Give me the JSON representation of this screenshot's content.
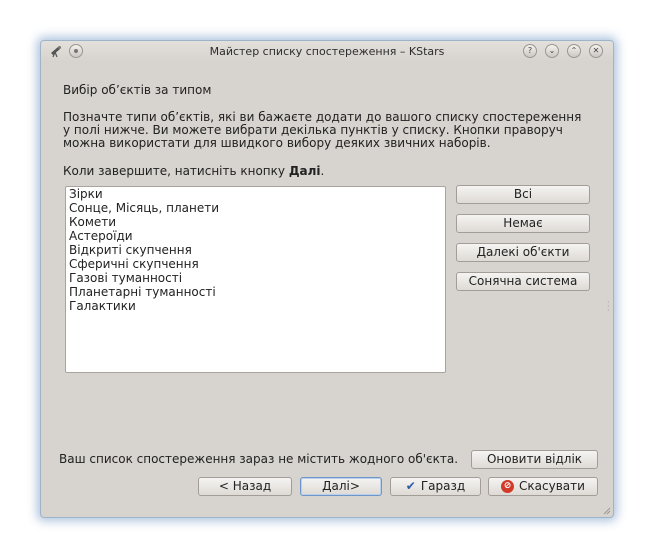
{
  "window": {
    "title": "Майстер списку спостереження – KStars",
    "controls": {
      "help": "?",
      "minimize": "⌄",
      "maximize": "⌃",
      "close": "✕"
    }
  },
  "page": {
    "heading": "Вибір об’єктів за типом",
    "description_lines": [
      "Позначте типи об’єктів, які ви бажаєте додати до вашого списку спостереження",
      "у полі нижче. Ви можете вибрати декілька пунктів у списку. Кнопки праворуч",
      "можна використати для швидкого вибору деяких звичних наборів."
    ],
    "instruction_prefix": "Коли завершите, натисніть кнопку ",
    "instruction_bold": "Далі",
    "instruction_suffix": "."
  },
  "object_types": [
    "Зірки",
    "Сонце, Місяць, планети",
    "Комети",
    "Астероїди",
    "Відкриті скупчення",
    "Сферичні скупчення",
    "Газові туманності",
    "Планетарні туманності",
    "Галактики"
  ],
  "quick_buttons": {
    "all": "Всі",
    "none": "Немає",
    "deep_sky": "Далекі об'єкти",
    "solar_system": "Сонячна система"
  },
  "status": {
    "text": "Ваш список спостереження зараз не містить жодного об'єкта.",
    "refresh_button": "Оновити відлік"
  },
  "nav_buttons": {
    "back": "< Назад",
    "next": "Далі>",
    "ok": "Гаразд",
    "cancel": "Скасувати"
  },
  "colors": {
    "window_bg": "#d7d3ce",
    "window_glow": "#4678b4",
    "cancel_icon": "#d23a2a",
    "ok_icon": "#2a5aa8"
  }
}
